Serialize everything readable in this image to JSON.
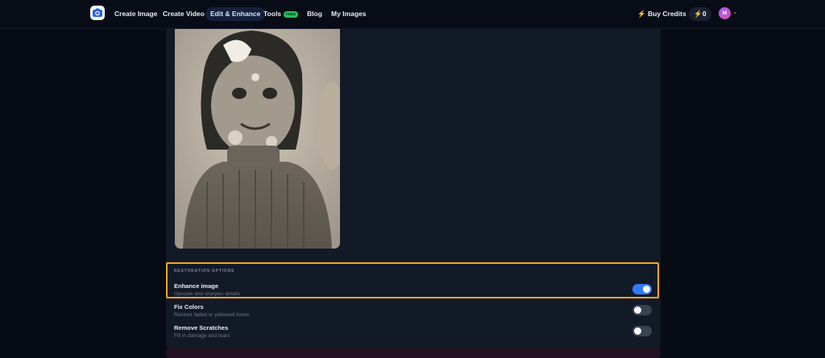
{
  "nav": {
    "items": [
      {
        "label": "Create Image"
      },
      {
        "label": "Create Video"
      },
      {
        "label": "Edit & Enhance",
        "active": true
      },
      {
        "label": "Tools",
        "badge": "FREE"
      },
      {
        "label": "Blog"
      },
      {
        "label": "My Images"
      }
    ],
    "buy_credits": "Buy Credits",
    "credits": "0",
    "avatar_initial": "M",
    "icons": {
      "bolt": "lightning-icon",
      "chevron": "chevron-down-icon",
      "logo": "camera-logo-icon"
    }
  },
  "restoration": {
    "section_title": "RESTORATION OPTIONS",
    "options": [
      {
        "title": "Enhance image",
        "desc": "Upscale and sharpen details",
        "enabled": true
      },
      {
        "title": "Fix Colors",
        "desc": "Restore faded or yellowed tones",
        "enabled": false
      },
      {
        "title": "Remove Scratches",
        "desc": "Fill in damage and tears",
        "enabled": false
      }
    ]
  },
  "colors": {
    "accent": "#2f7cf6",
    "highlight": "#f5a623",
    "badge": "#22c55e"
  }
}
